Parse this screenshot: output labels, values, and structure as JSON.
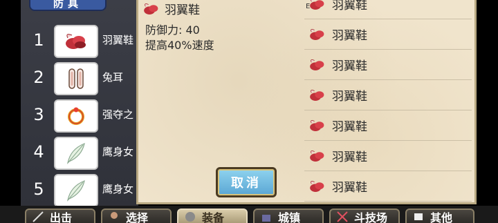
{
  "left_panel": {
    "tab_label": "防具",
    "rows": [
      {
        "num": "1",
        "name": "羽翼鞋",
        "icon": "winged-shoes-icon"
      },
      {
        "num": "2",
        "name": "兔耳",
        "icon": "bunny-ears-icon"
      },
      {
        "num": "3",
        "name": "强夺之",
        "icon": "ring-icon"
      },
      {
        "num": "4",
        "name": "鹰身女",
        "icon": "feather-icon"
      },
      {
        "num": "5",
        "name": "鹰身女",
        "icon": "feather-icon"
      }
    ]
  },
  "detail": {
    "item_name": "羽翼鞋",
    "defense": "防御力: 40",
    "effect": "提高40%速度"
  },
  "list": {
    "marker": "E",
    "items": [
      "羽翼鞋",
      "羽翼鞋",
      "羽翼鞋",
      "羽翼鞋",
      "羽翼鞋",
      "羽翼鞋",
      "羽翼鞋"
    ]
  },
  "cancel_label": "取消",
  "bottom_tabs": [
    {
      "label": "出击",
      "icon": "sword-icon"
    },
    {
      "label": "选择",
      "icon": "character-icon"
    },
    {
      "label": "装备",
      "icon": "armor-icon",
      "active": true
    },
    {
      "label": "城镇",
      "icon": "castle-icon"
    },
    {
      "label": "斗技场",
      "icon": "crossed-swords-icon"
    },
    {
      "label": "其他",
      "icon": "scroll-icon"
    }
  ],
  "colors": {
    "accent": "#3a5aa0",
    "parchment": "#f0e4cc",
    "shoe": "#c0303a"
  }
}
